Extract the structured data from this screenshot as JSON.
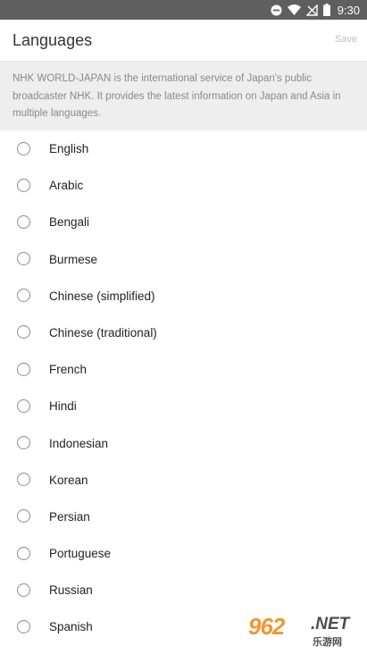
{
  "status_bar": {
    "time": "9:30",
    "icons": [
      "do-not-disturb-icon",
      "wifi-icon",
      "no-signal-icon",
      "battery-icon"
    ]
  },
  "app_bar": {
    "title": "Languages",
    "save_label": "Save"
  },
  "info": {
    "text": "NHK WORLD-JAPAN is the international service of Japan's public broadcaster NHK. It provides the latest information on Japan and Asia in multiple languages."
  },
  "languages": [
    {
      "label": "English"
    },
    {
      "label": "Arabic"
    },
    {
      "label": "Bengali"
    },
    {
      "label": "Burmese"
    },
    {
      "label": "Chinese (simplified)"
    },
    {
      "label": "Chinese (traditional)"
    },
    {
      "label": "French"
    },
    {
      "label": "Hindi"
    },
    {
      "label": "Indonesian"
    },
    {
      "label": "Korean"
    },
    {
      "label": "Persian"
    },
    {
      "label": "Portuguese"
    },
    {
      "label": "Russian"
    },
    {
      "label": "Spanish"
    }
  ],
  "watermark": {
    "number": "962",
    "suffix": ".NET",
    "chinese": "乐游网"
  },
  "colors": {
    "status_bar": "#5f5f5f",
    "info_background": "#eeeeee",
    "save_disabled": "#bdbdbd",
    "radio_border": "#8c8c8c"
  }
}
